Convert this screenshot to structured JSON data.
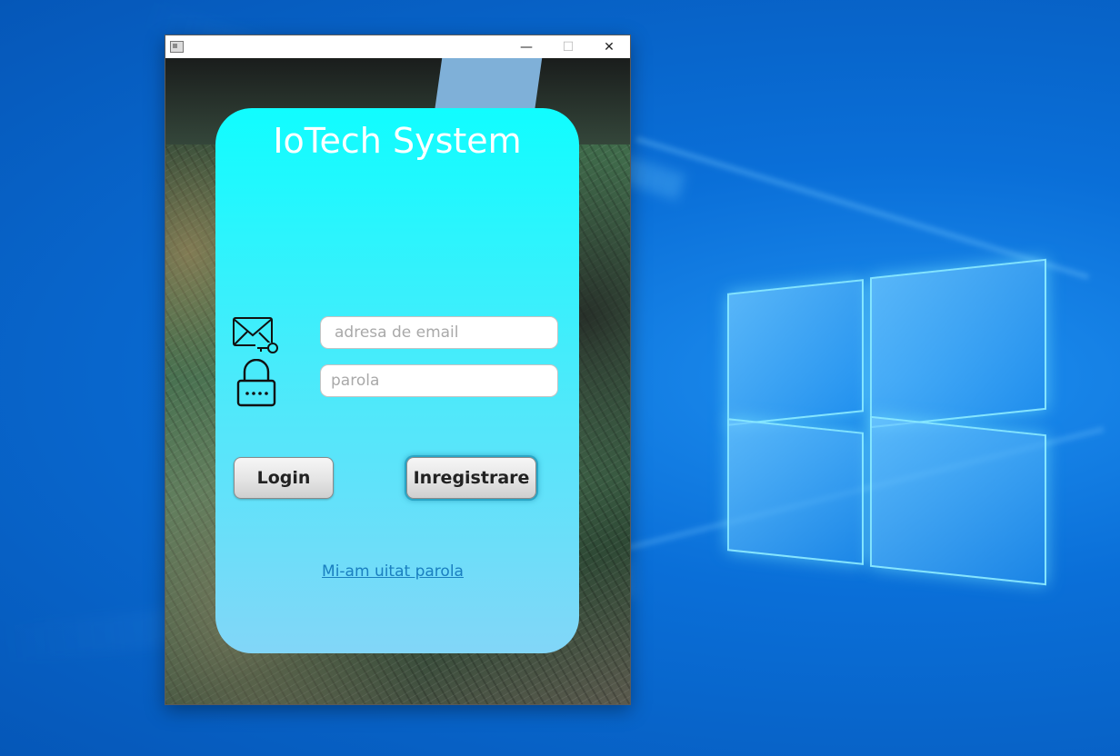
{
  "window": {
    "title": "",
    "controls": {
      "minimize": "—",
      "maximize": "☐",
      "close": "✕"
    }
  },
  "login_card": {
    "title": "IoTech System",
    "email": {
      "placeholder": "adresa de email",
      "value": ""
    },
    "password": {
      "placeholder": "parola",
      "value": ""
    },
    "login_button": "Login",
    "register_button": "Inregistrare",
    "forgot_link": "Mi-am uitat parola"
  },
  "icons": [
    "window-app-icon",
    "email-key-icon",
    "padlock-password-icon"
  ],
  "colors": {
    "card_top": "#10fdff",
    "card_bottom": "#82d6f8",
    "link": "#1a7fc0",
    "desktop": "#0a6fd8"
  }
}
